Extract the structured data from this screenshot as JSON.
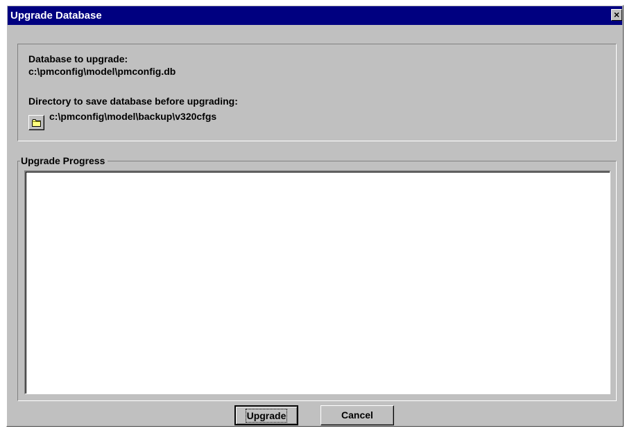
{
  "window": {
    "title": "Upgrade Database",
    "close_symbol": "×"
  },
  "info": {
    "database_label": "Database to upgrade:",
    "database_path": "c:\\pmconfig\\model\\pmconfig.db",
    "backup_dir_label": "Directory to save database before upgrading:",
    "backup_dir_path": "c:\\pmconfig\\model\\backup\\v320cfgs",
    "browse_icon": "folder-icon"
  },
  "progress": {
    "group_label": "Upgrade Progress",
    "log_text": ""
  },
  "buttons": {
    "upgrade_label": "Upgrade",
    "cancel_label": "Cancel"
  },
  "colors": {
    "titlebar": "#000080",
    "dialog_face": "#c0c0c0",
    "folder_icon": "#ffff80"
  }
}
